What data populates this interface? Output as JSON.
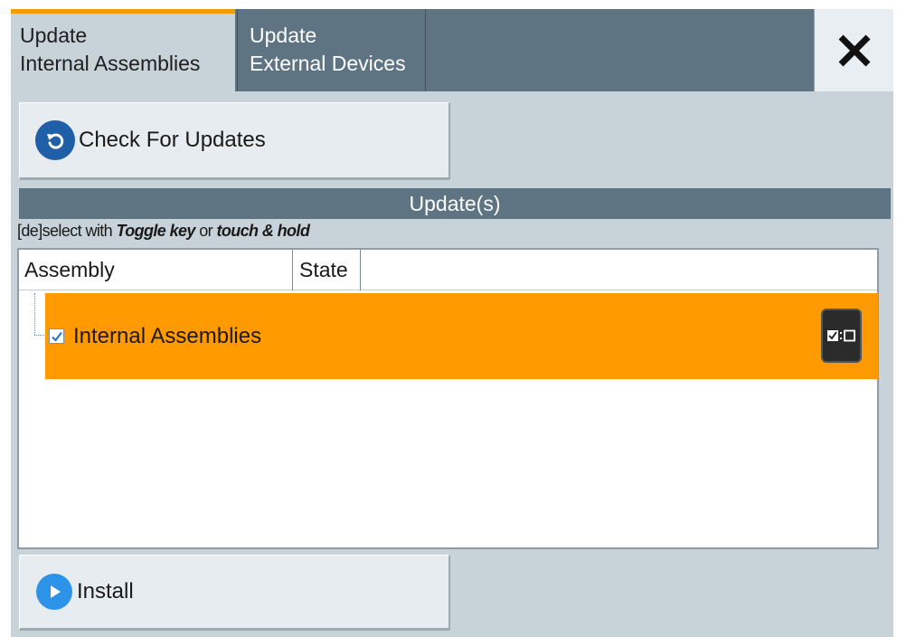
{
  "tabs": {
    "internal": {
      "line1": "Update",
      "line2": "Internal Assemblies"
    },
    "external": {
      "line1": "Update",
      "line2": "External Devices"
    }
  },
  "close_icon": "close-x-icon",
  "check_button": {
    "label": "Check For Updates",
    "icon": "refresh-icon"
  },
  "updates_section": {
    "header": "Update(s)",
    "hint_prefix": "[de]select with ",
    "hint_key": "Toggle key",
    "hint_mid": " or ",
    "hint_touch": "touch & hold"
  },
  "table": {
    "columns": [
      "Assembly",
      "State",
      ""
    ],
    "rows": [
      {
        "label": "Internal Assemblies",
        "checked": true,
        "state": "",
        "selected": true
      }
    ]
  },
  "install_button": {
    "label": "Install",
    "icon": "play-icon"
  },
  "colors": {
    "accent_orange": "#ff9a00",
    "tab_bar": "#5e7482",
    "panel_bg": "#c8d3d9",
    "refresh_icon_blue": "#1f5fa8",
    "play_icon_blue": "#2c93e8"
  }
}
